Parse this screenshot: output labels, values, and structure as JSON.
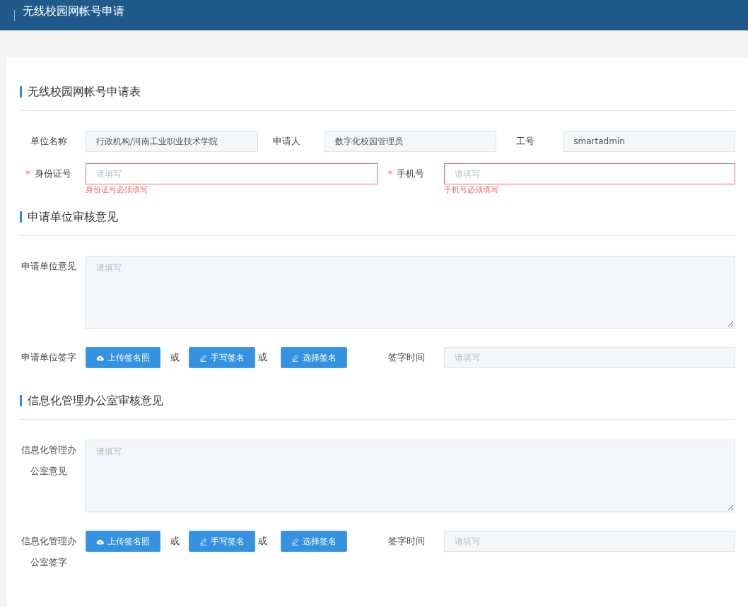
{
  "header": {
    "title": "无线校园网帐号申请"
  },
  "sections": [
    {
      "title": "无线校园网帐号申请表",
      "rows": [
        {
          "kind": "fields",
          "fields": [
            {
              "label": "单位名称",
              "value": "行政机构/河南工业职业技术学院"
            },
            {
              "label": "申请人",
              "value": "数字化校园管理员"
            },
            {
              "label": "工号",
              "value": "smartadmin"
            }
          ]
        },
        {
          "kind": "fields",
          "fields": [
            {
              "label": "身份证号",
              "required_mark": "*",
              "placeholder": "请填写",
              "error": "身份证号必须填写"
            },
            {
              "label": "手机号",
              "required_mark": "*",
              "placeholder": "请填写",
              "error": "手机号必须填写"
            }
          ]
        }
      ]
    },
    {
      "title": "申请单位审核意见",
      "rows": [
        {
          "kind": "textarea",
          "label": "申请单位意见",
          "placeholder": "请填写"
        },
        {
          "kind": "signature",
          "label": "申请单位签字",
          "items": [
            {
              "kind": "button",
              "label": "上传签名照"
            },
            {
              "kind": "separator",
              "text": "或"
            },
            {
              "kind": "button",
              "label": "手写签名"
            },
            {
              "kind": "separator",
              "text": "或"
            },
            {
              "kind": "button",
              "label": "选择签名"
            }
          ],
          "time": {
            "label": "签字时间",
            "placeholder": "请填写"
          }
        }
      ]
    },
    {
      "title": "信息化管理办公室审核意见",
      "rows": [
        {
          "kind": "textarea",
          "label": "信息化管理办公室意见",
          "placeholder": "请填写"
        },
        {
          "kind": "signature",
          "label": "信息化管理办公室签字",
          "items": [
            {
              "kind": "button",
              "label": "上传签名照"
            },
            {
              "kind": "separator",
              "text": "或"
            },
            {
              "kind": "button",
              "label": "手写签名"
            },
            {
              "kind": "separator",
              "text": "或"
            },
            {
              "kind": "button",
              "label": "选择签名"
            }
          ],
          "time": {
            "label": "签字时间",
            "placeholder": "请填写"
          }
        }
      ]
    }
  ]
}
